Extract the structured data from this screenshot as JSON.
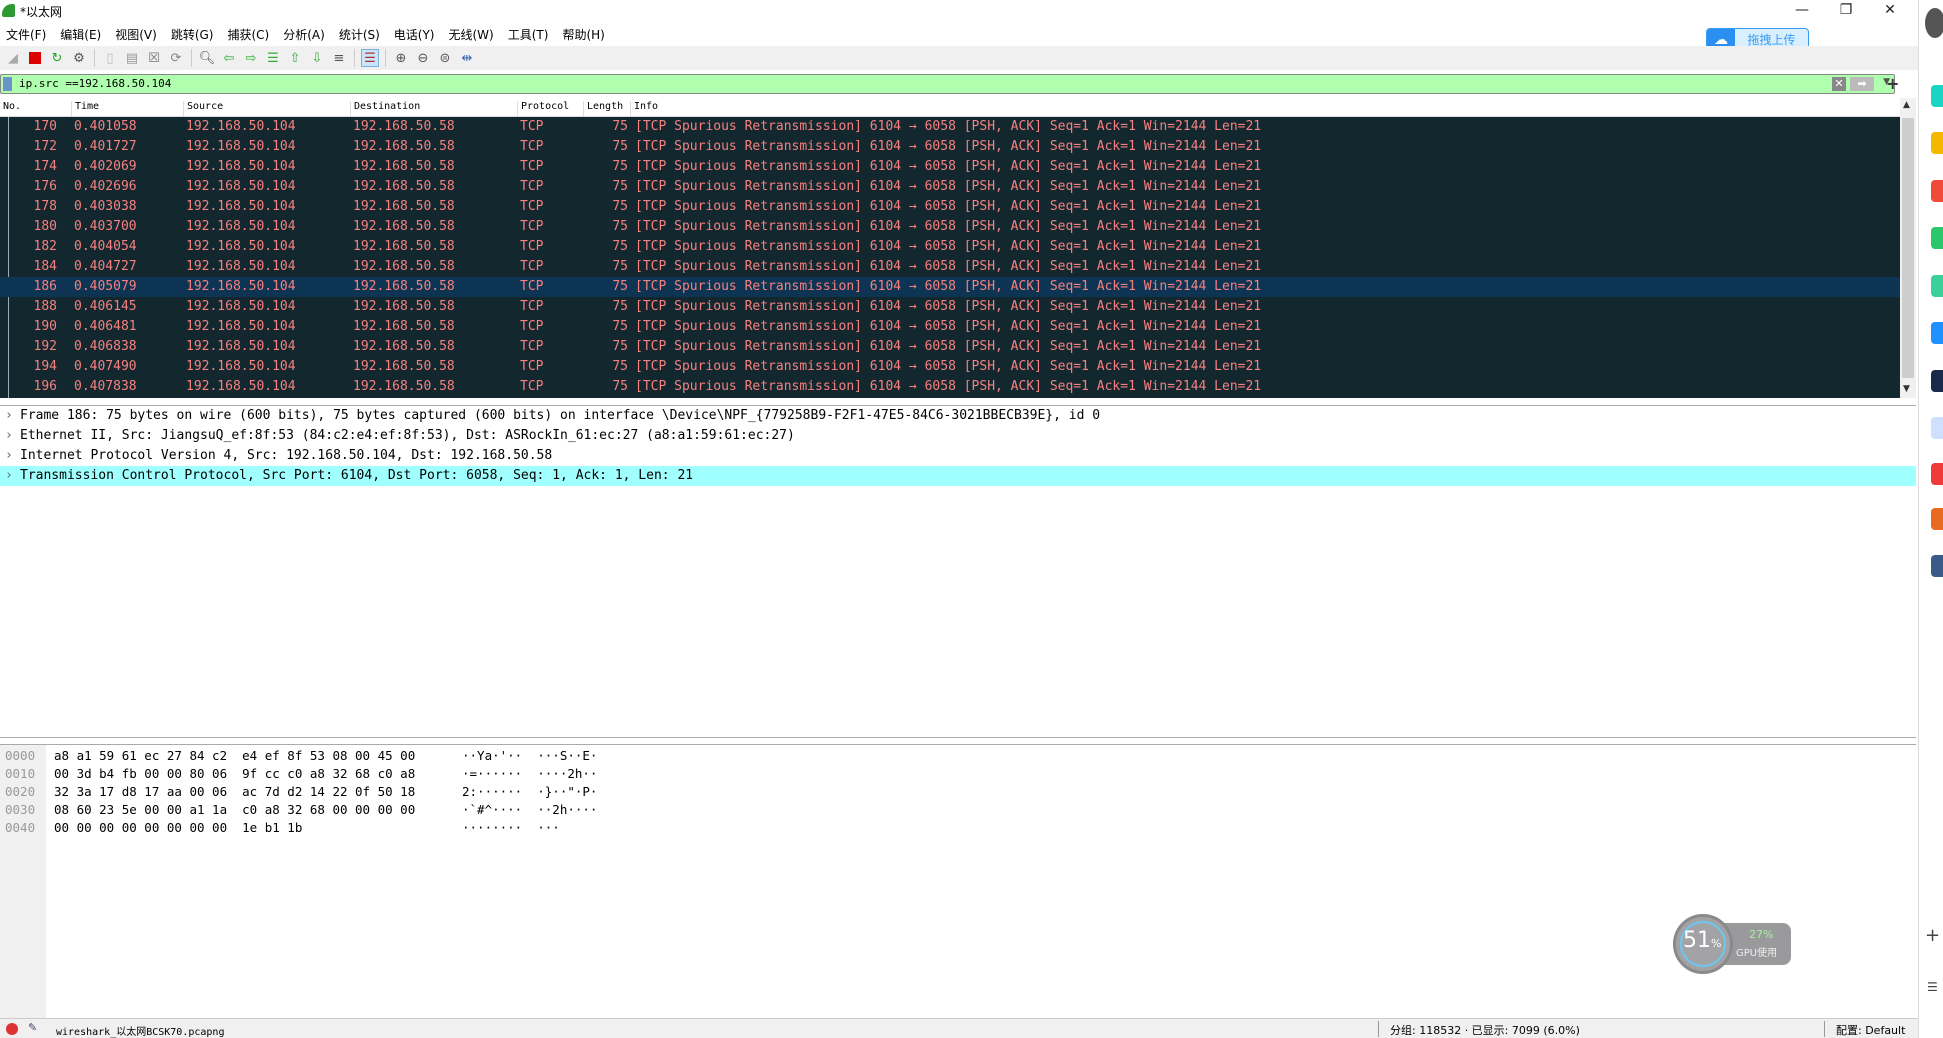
{
  "window": {
    "title": "*以太网",
    "minimize": "—",
    "restore": "❐",
    "close": "✕"
  },
  "menu": [
    "文件(F)",
    "编辑(E)",
    "视图(V)",
    "跳转(G)",
    "捕获(C)",
    "分析(A)",
    "统计(S)",
    "电话(Y)",
    "无线(W)",
    "工具(T)",
    "帮助(H)"
  ],
  "upload": {
    "label": "拖拽上传",
    "icon": "cloud-icon"
  },
  "filter": {
    "value": "ip.src ==192.168.50.104",
    "color": "#afffaf"
  },
  "columns": [
    "No.",
    "Time",
    "Source",
    "Destination",
    "Protocol",
    "Length",
    "Info"
  ],
  "packets": [
    {
      "no": "170",
      "time": "0.401058"
    },
    {
      "no": "172",
      "time": "0.401727"
    },
    {
      "no": "174",
      "time": "0.402069"
    },
    {
      "no": "176",
      "time": "0.402696"
    },
    {
      "no": "178",
      "time": "0.403038"
    },
    {
      "no": "180",
      "time": "0.403700"
    },
    {
      "no": "182",
      "time": "0.404054"
    },
    {
      "no": "184",
      "time": "0.404727"
    },
    {
      "no": "186",
      "time": "0.405079",
      "selected": true
    },
    {
      "no": "188",
      "time": "0.406145"
    },
    {
      "no": "190",
      "time": "0.406481"
    },
    {
      "no": "192",
      "time": "0.406838"
    },
    {
      "no": "194",
      "time": "0.407490"
    },
    {
      "no": "196",
      "time": "0.407838"
    }
  ],
  "packet_common": {
    "source": "192.168.50.104",
    "destination": "192.168.50.58",
    "protocol": "TCP",
    "length": "75",
    "info": "[TCP Spurious Retransmission] 6104 → 6058 [PSH, ACK] Seq=1 Ack=1 Win=2144 Len=21"
  },
  "colors": {
    "row_bg": "#12272e",
    "row_fg": "#f78080",
    "selected_bg": "#0d3452",
    "detail_selected": "#a0ffff"
  },
  "details": [
    "Frame 186: 75 bytes on wire (600 bits), 75 bytes captured (600 bits) on interface \\Device\\NPF_{779258B9-F2F1-47E5-84C6-3021BBECB39E}, id 0",
    "Ethernet II, Src: JiangsuQ_ef:8f:53 (84:c2:e4:ef:8f:53), Dst: ASRockIn_61:ec:27 (a8:a1:59:61:ec:27)",
    "Internet Protocol Version 4, Src: 192.168.50.104, Dst: 192.168.50.58",
    "Transmission Control Protocol, Src Port: 6104, Dst Port: 6058, Seq: 1, Ack: 1, Len: 21"
  ],
  "bytes": [
    {
      "off": "0000",
      "hex": "a8 a1 59 61 ec 27 84 c2  e4 ef 8f 53 08 00 45 00",
      "ascii": "··Ya·'··  ···S··E·"
    },
    {
      "off": "0010",
      "hex": "00 3d b4 fb 00 00 80 06  9f cc c0 a8 32 68 c0 a8",
      "ascii": "·=······  ····2h··"
    },
    {
      "off": "0020",
      "hex": "32 3a 17 d8 17 aa 00 06  ac 7d d2 14 22 0f 50 18",
      "ascii": "2:······  ·}··\"·P·"
    },
    {
      "off": "0030",
      "hex": "08 60 23 5e 00 00 a1 1a  c0 a8 32 68 00 00 00 00",
      "ascii": "·`#^····  ··2h····"
    },
    {
      "off": "0040",
      "hex": "00 00 00 00 00 00 00 00  1e b1 1b",
      "ascii": "········  ···"
    }
  ],
  "status": {
    "file": "wireshark_以太网BCSK70.pcapng",
    "packets": "分组: 118532 · 已显示: 7099 (6.0%)",
    "profile": "配置: Default"
  },
  "gpu_widget": {
    "cpu": "51",
    "cpu_unit": "%",
    "gpu": "27%",
    "gpu_label": "GPU使用"
  }
}
